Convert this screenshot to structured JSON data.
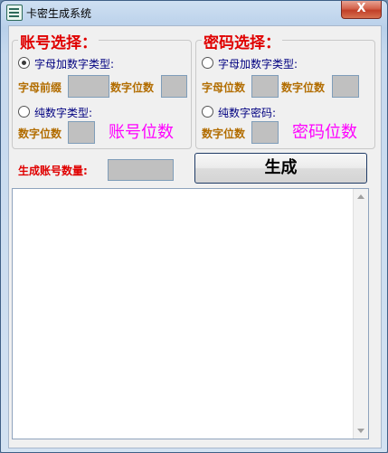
{
  "window": {
    "title": "卡密生成系统",
    "close_glyph": "X"
  },
  "account_group": {
    "legend": "账号选择：",
    "option_alnum": "字母加数字类型:",
    "prefix_label": "字母前缀",
    "digits_label_1": "数字位数",
    "option_numeric": "纯数字类型:",
    "digits_label_2": "数字位数",
    "big_label": "账号位数",
    "selected": "alnum"
  },
  "password_group": {
    "legend": "密码选择：",
    "option_alnum": "字母加数字类型:",
    "letters_label": "字母位数",
    "digits_label_1": "数字位数",
    "option_numeric": "纯数字密码:",
    "digits_label_2": "数字位数",
    "big_label": "密码位数",
    "selected": "none"
  },
  "quantity": {
    "label": "生成账号数量:"
  },
  "generate_button": {
    "label": "生成"
  },
  "output": {
    "text": ""
  },
  "colors": {
    "legend": "#e00000",
    "label_brown": "#b26d00",
    "label_magenta": "#ff00ff",
    "radio_text": "#000080"
  }
}
